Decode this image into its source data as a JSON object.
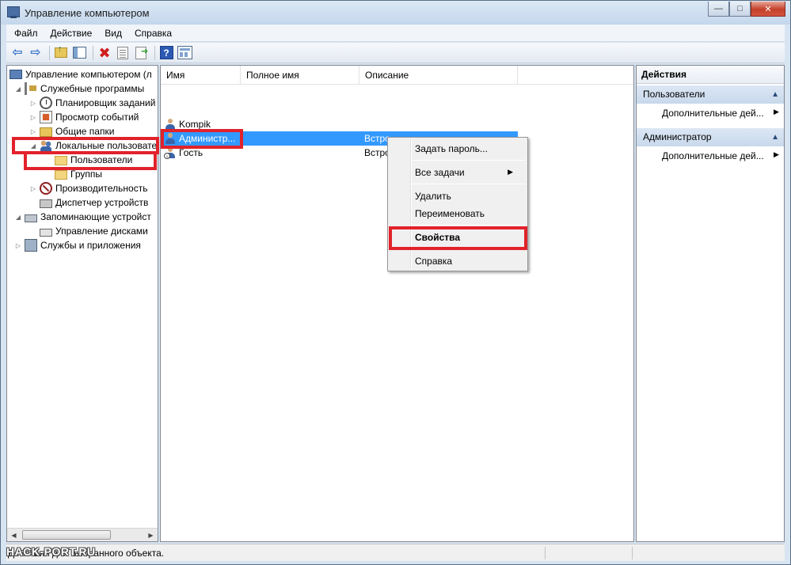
{
  "window": {
    "title": "Управление компьютером",
    "controls": {
      "minimize": "—",
      "maximize": "□",
      "close": "✕"
    }
  },
  "menu": [
    "Файл",
    "Действие",
    "Вид",
    "Справка"
  ],
  "toolbar": {
    "icons": [
      "back-arrow-icon",
      "forward-arrow-icon",
      "up-folder-icon",
      "show-hide-tree-icon",
      "delete-icon",
      "properties-icon",
      "export-list-icon",
      "help-icon",
      "view-options-icon"
    ]
  },
  "tree": {
    "items": [
      {
        "label": "Управление компьютером (л",
        "indent": 0,
        "expander": "",
        "icon": "computer"
      },
      {
        "label": "Служебные программы",
        "indent": 1,
        "expander": "◢",
        "icon": "tools"
      },
      {
        "label": "Планировщик заданий",
        "indent": 2,
        "expander": "▷",
        "icon": "clock"
      },
      {
        "label": "Просмотр событий",
        "indent": 2,
        "expander": "▷",
        "icon": "events"
      },
      {
        "label": "Общие папки",
        "indent": 2,
        "expander": "▷",
        "icon": "share"
      },
      {
        "label": "Локальные пользовате",
        "indent": 2,
        "expander": "◢",
        "icon": "users"
      },
      {
        "label": "Пользователи",
        "indent": 3,
        "expander": "",
        "icon": "folder"
      },
      {
        "label": "Группы",
        "indent": 3,
        "expander": "",
        "icon": "folder"
      },
      {
        "label": "Производительность",
        "indent": 2,
        "expander": "▷",
        "icon": "perf"
      },
      {
        "label": "Диспетчер устройств",
        "indent": 2,
        "expander": "",
        "icon": "devmgr"
      },
      {
        "label": "Запоминающие устройст",
        "indent": 1,
        "expander": "◢",
        "icon": "storage"
      },
      {
        "label": "Управление дисками",
        "indent": 2,
        "expander": "",
        "icon": "disk"
      },
      {
        "label": "Службы и приложения",
        "indent": 1,
        "expander": "▷",
        "icon": "services"
      }
    ],
    "scroll_left": "◀",
    "scroll_right": "▶"
  },
  "list": {
    "columns": [
      "Имя",
      "Полное имя",
      "Описание"
    ],
    "rows": [
      {
        "name": "Kompik",
        "description": "",
        "selected": false,
        "disabled": false
      },
      {
        "name": "Администр...",
        "description": "Встро",
        "selected": true,
        "disabled": false
      },
      {
        "name": "Гость",
        "description": "Встро",
        "selected": false,
        "disabled": true
      }
    ]
  },
  "context_menu": {
    "items": [
      {
        "label": "Задать пароль..."
      },
      {
        "label": "Все задачи",
        "submenu": "▶"
      },
      {
        "label": "Удалить"
      },
      {
        "label": "Переименовать"
      },
      {
        "label": "Свойства",
        "bold": true
      },
      {
        "label": "Справка"
      }
    ]
  },
  "actions": {
    "title": "Действия",
    "groups": [
      {
        "label": "Пользователи",
        "collapse": "▲",
        "item": "Дополнительные дей...",
        "more": "▶"
      },
      {
        "label": "Администратор",
        "collapse": "▲",
        "item": "Дополнительные дей...",
        "more": "▶"
      }
    ]
  },
  "status": {
    "text": "Действия для выбранного объекта.",
    "watermark": "HACK-PORT.RU"
  },
  "colors": {
    "highlight": "#e2222b",
    "selection": "#3399ff"
  }
}
